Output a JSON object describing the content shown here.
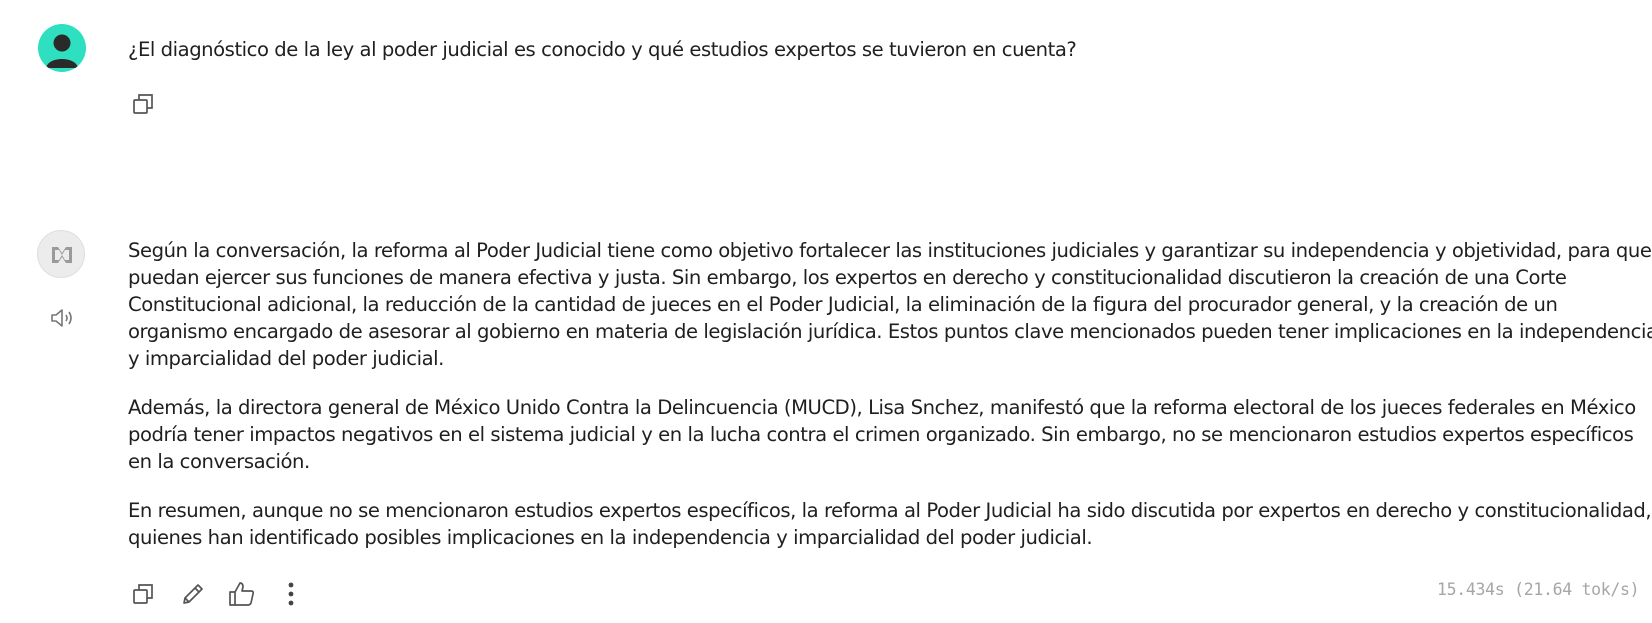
{
  "conversation": {
    "user_message": {
      "text": "¿El diagnóstico de la ley al poder judicial es conocido y qué estudios expertos se tuvieron en cuenta?",
      "avatar_icon": "user-avatar-icon",
      "avatar_color": "#2ee0c0",
      "actions": {
        "copy_icon": "copy-icon"
      }
    },
    "assistant_message": {
      "avatar_icon": "model-logo-icon",
      "speak_icon": "speaker-icon",
      "paragraphs": [
        "Según la conversación, la reforma al Poder Judicial tiene como objetivo fortalecer las instituciones judiciales y garantizar su independencia y objetividad, para que puedan ejercer sus funciones de manera efectiva y justa. Sin embargo, los expertos en derecho y constitucionalidad discutieron la creación de una Corte Constitucional adicional, la reducción de la cantidad de jueces en el Poder Judicial, la eliminación de la figura del procurador general, y la creación de un organismo encargado de asesorar al gobierno en materia de legislación jurídica. Estos puntos clave mencionados pueden tener implicaciones en la independencia y imparcialidad del poder judicial.",
        "Además, la directora general de México Unido Contra la Delincuencia (MUCD), Lisa Snchez, manifestó que la reforma electoral de los jueces federales en México podría tener impactos negativos en el sistema judicial y en la lucha contra el crimen organizado. Sin embargo, no se mencionaron estudios expertos específicos en la conversación.",
        "En resumen, aunque no se mencionaron estudios expertos específicos, la reforma al Poder Judicial ha sido discutida por expertos en derecho y constitucionalidad, quienes han identificado posibles implicaciones en la independencia y imparcialidad del poder judicial."
      ],
      "actions": [
        "copy-icon",
        "edit-icon",
        "thumbs-up-icon",
        "more-options-icon"
      ],
      "timing": "15.434s (21.64 tok/s)"
    }
  }
}
